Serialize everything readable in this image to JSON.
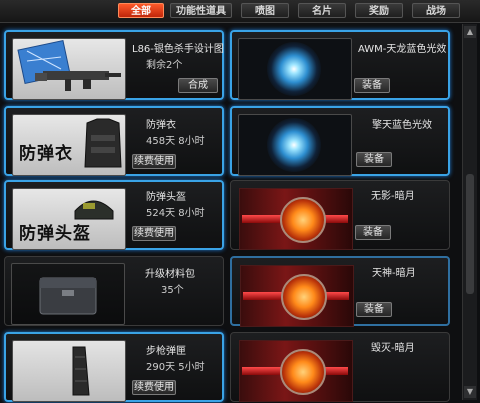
{
  "tabs": [
    {
      "label": "全部",
      "active": true
    },
    {
      "label": "功能性道具",
      "active": false
    },
    {
      "label": "喷图",
      "active": false
    },
    {
      "label": "名片",
      "active": false
    },
    {
      "label": "奖励",
      "active": false
    },
    {
      "label": "战场",
      "active": false
    }
  ],
  "left_items": [
    {
      "name": "L86-银色杀手设计图",
      "sub": "剩余2个",
      "button": "合成",
      "thumb_text": ""
    },
    {
      "name": "防弹衣",
      "sub": "458天 8小时",
      "button": "续费使用",
      "thumb_text": "防弹衣"
    },
    {
      "name": "防弹头盔",
      "sub": "524天 8小时",
      "button": "续费使用",
      "thumb_text": "防弹头盔"
    },
    {
      "name": "升级材料包",
      "sub": "35个",
      "button": "",
      "thumb_text": ""
    },
    {
      "name": "步枪弹匣",
      "sub": "290天 5小时",
      "button": "续费使用",
      "thumb_text": ""
    }
  ],
  "right_items": [
    {
      "name": "AWM-天龙蓝色光效",
      "button": "装备"
    },
    {
      "name": "擎天蓝色光效",
      "button": "装备"
    },
    {
      "name": "无影-暗月",
      "button": "装备"
    },
    {
      "name": "天神-暗月",
      "button": "装备"
    },
    {
      "name": "毁灭-暗月",
      "button": ""
    }
  ],
  "icons": {
    "scroll_up": "▲",
    "scroll_down": "▼"
  },
  "colors": {
    "accent": "#3aa3e6",
    "active_tab": "#e8401a"
  }
}
